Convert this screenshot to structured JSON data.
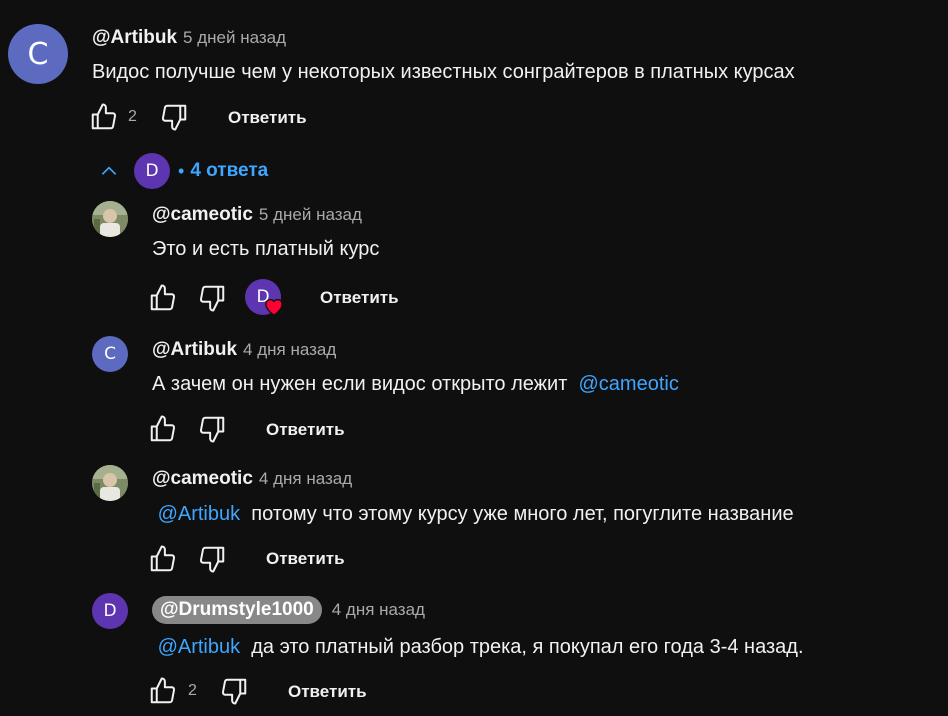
{
  "main_comment": {
    "avatar_letter": "C",
    "author": "@Artibuk",
    "time": "5 дней назад",
    "text": "Видос получше чем у некоторых известных сонграйтеров в платных курсах",
    "likes": "2",
    "reply_label": "Ответить"
  },
  "replies_toggle": {
    "avatar_letter": "D",
    "label": "4 ответа"
  },
  "replies": [
    {
      "author": "@cameotic",
      "time": "5 дней назад",
      "text": "Это и есть платный курс",
      "reply_label": "Ответить",
      "creator_heart_letter": "D"
    },
    {
      "avatar_letter": "C",
      "author": "@Artibuk",
      "time": "4 дня назад",
      "text": "А зачем он нужен если видос открыто лежит",
      "mention": "@cameotic",
      "reply_label": "Ответить"
    },
    {
      "author": "@cameotic",
      "time": "4 дня назад",
      "mention": "@Artibuk",
      "text": "потому что этому курсу уже много лет, погуглите название",
      "reply_label": "Ответить"
    },
    {
      "avatar_letter": "D",
      "author": "@Drumstyle1000",
      "time": "4 дня назад",
      "mention": "@Artibuk",
      "text": "да это платный разбор трека, я покупал его года 3-4 назад.",
      "likes": "2",
      "reply_label": "Ответить"
    }
  ],
  "colors": {
    "background": "#0f0f0f",
    "mention": "#3ea6ff",
    "avatar_c": "#5c6bc0",
    "avatar_d": "#5e35b1",
    "heart": "#ff0033"
  },
  "icons": [
    "like-icon",
    "dislike-icon",
    "chevron-up-icon",
    "heart-icon"
  ]
}
